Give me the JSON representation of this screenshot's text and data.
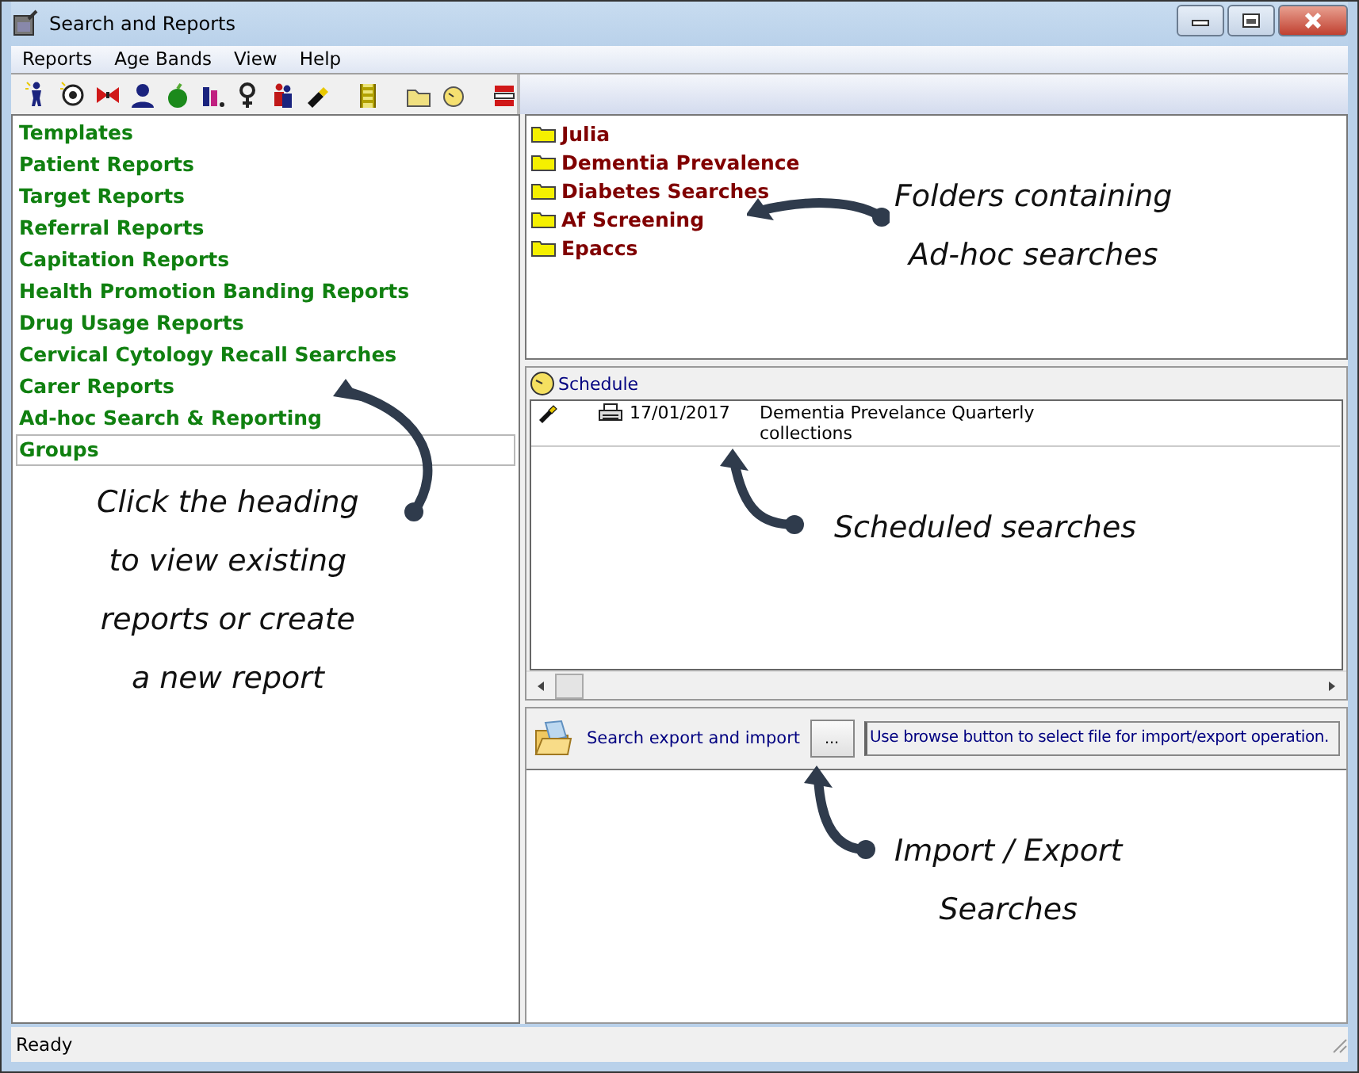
{
  "window": {
    "title": "Search and Reports"
  },
  "menu": [
    "Reports",
    "Age Bands",
    "View",
    "Help"
  ],
  "reports": [
    {
      "label": "Templates",
      "selected": false
    },
    {
      "label": "Patient Reports",
      "selected": false
    },
    {
      "label": "Target Reports",
      "selected": false
    },
    {
      "label": "Referral Reports",
      "selected": false
    },
    {
      "label": "Capitation Reports",
      "selected": false
    },
    {
      "label": "Health Promotion Banding Reports",
      "selected": false
    },
    {
      "label": "Drug Usage Reports",
      "selected": false
    },
    {
      "label": "Cervical Cytology Recall Searches",
      "selected": false
    },
    {
      "label": "Carer Reports",
      "selected": false
    },
    {
      "label": "Ad-hoc Search & Reporting",
      "selected": false
    },
    {
      "label": "Groups",
      "selected": true
    }
  ],
  "folders": [
    "Julia",
    "Dementia Prevalence",
    "Diabetes Searches",
    "Af Screening",
    "Epaccs"
  ],
  "schedule": {
    "title": "Schedule",
    "rows": [
      {
        "date": "17/01/2017",
        "description": "Dementia Prevelance Quarterly collections"
      }
    ]
  },
  "export": {
    "label": "Search export and import",
    "browse_button": "...",
    "value": "Use browse button to select file for import/export operation."
  },
  "status_bar": "Ready",
  "callouts": {
    "folders": "Folders containing\nAd-hoc searches",
    "reports": "Click the heading\nto view existing\nreports or create\na new report",
    "schedule": "Scheduled searches",
    "export": "Import / Export\nSearches"
  }
}
